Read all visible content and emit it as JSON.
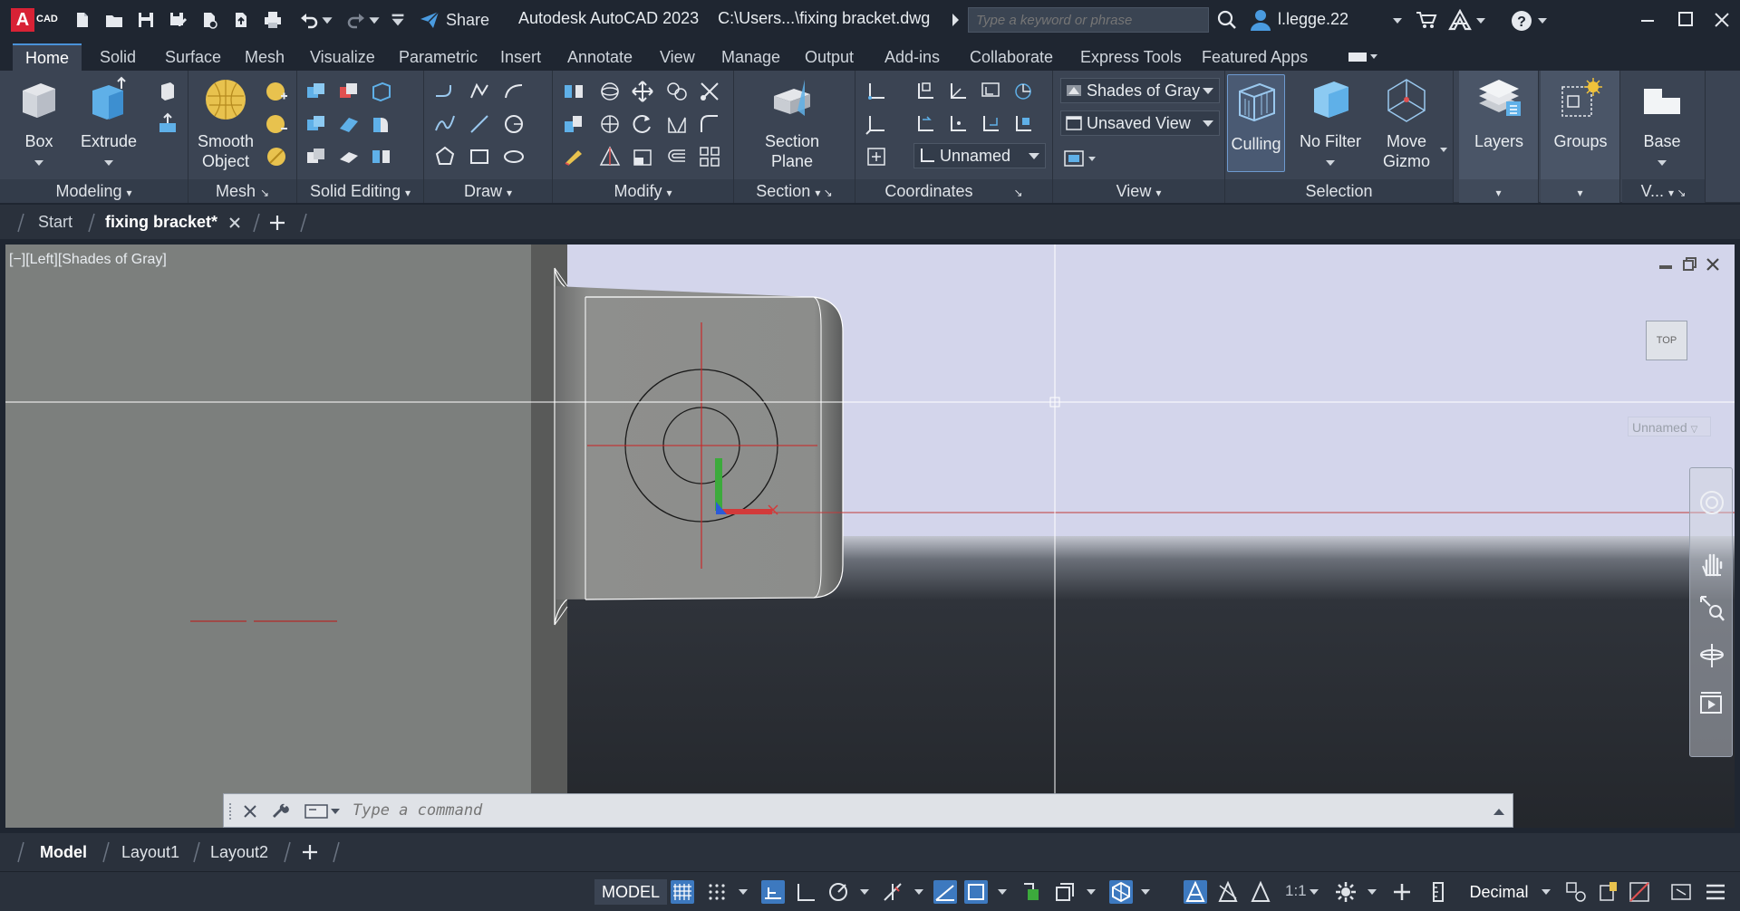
{
  "app": {
    "logo_text": "CAD",
    "title": "Autodesk AutoCAD 2023",
    "file_path": "C:\\Users...\\fixing bracket.dwg",
    "share_label": "Share",
    "search_placeholder": "Type a keyword or phrase",
    "user_name": "l.legge.22"
  },
  "ribbon_tabs": [
    "Home",
    "Solid",
    "Surface",
    "Mesh",
    "Visualize",
    "Parametric",
    "Insert",
    "Annotate",
    "View",
    "Manage",
    "Output",
    "Add-ins",
    "Collaborate",
    "Express Tools",
    "Featured Apps"
  ],
  "ribbon": {
    "modeling": {
      "title": "Modeling",
      "box": "Box",
      "extrude": "Extrude"
    },
    "mesh": {
      "title": "Mesh",
      "smooth_object_1": "Smooth",
      "smooth_object_2": "Object"
    },
    "solid_editing": {
      "title": "Solid Editing"
    },
    "draw": {
      "title": "Draw"
    },
    "modify": {
      "title": "Modify"
    },
    "section": {
      "title": "Section",
      "section_plane_1": "Section",
      "section_plane_2": "Plane"
    },
    "coordinates": {
      "title": "Coordinates",
      "ucs_dropdown": "Unnamed"
    },
    "view": {
      "title": "View",
      "visual_style": "Shades of Gray",
      "named_view": "Unsaved View"
    },
    "selection": {
      "title": "Selection",
      "culling": "Culling",
      "no_filter": "No Filter",
      "move_gizmo_1": "Move",
      "move_gizmo_2": "Gizmo"
    },
    "layers": {
      "title": "Layers"
    },
    "groups": {
      "title": "Groups"
    },
    "base": {
      "label": "Base",
      "title": "V..."
    }
  },
  "file_tabs": {
    "start": "Start",
    "active": "fixing bracket*"
  },
  "viewport": {
    "label": "[−][Left][Shades of Gray]",
    "viewcube_face": "TOP",
    "ucs_name": "Unnamed"
  },
  "command_line": {
    "placeholder": "Type a command"
  },
  "layout_tabs": [
    "Model",
    "Layout1",
    "Layout2"
  ],
  "status_bar": {
    "model": "MODEL",
    "scale": "1:1",
    "units": "Decimal"
  },
  "colors": {
    "accent": "#3d79bf",
    "viewport_bg": "#7c7f7d",
    "sky": "#d3d5eb",
    "ground": "#24272c",
    "crosshair": "#cc2222"
  }
}
